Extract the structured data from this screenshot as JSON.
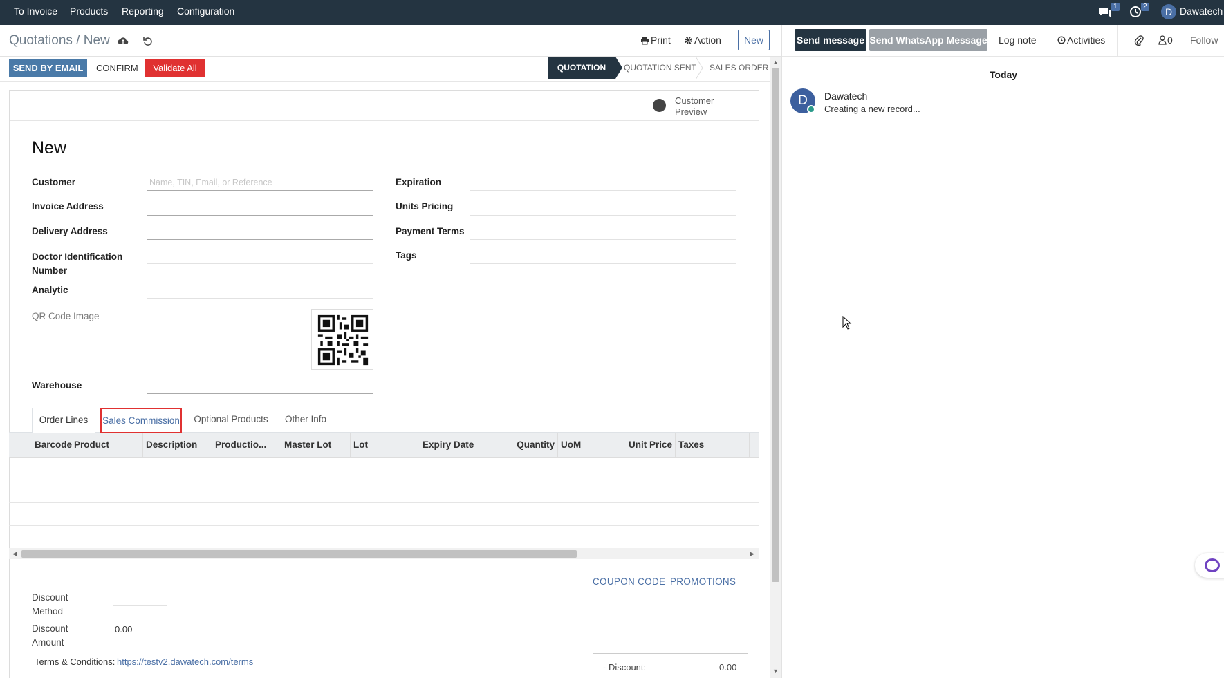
{
  "navbar": {
    "menu": [
      "To Invoice",
      "Products",
      "Reporting",
      "Configuration"
    ],
    "messages_count": "1",
    "activities_count": "2",
    "user_initial": "D",
    "user_name": "Dawatech"
  },
  "control_panel": {
    "breadcrumb_parent": "Quotations",
    "breadcrumb_sep": "/",
    "breadcrumb_current": "New",
    "print_label": "Print",
    "action_label": "Action",
    "new_label": "New"
  },
  "status_bar": {
    "send_email_label": "SEND BY EMAIL",
    "confirm_label": "CONFIRM",
    "validate_all_label": "Validate All",
    "stages": [
      "QUOTATION",
      "QUOTATION SENT",
      "SALES ORDER"
    ],
    "active_stage": "QUOTATION"
  },
  "form": {
    "customer_preview_line1": "Customer",
    "customer_preview_line2": "Preview",
    "title": "New",
    "customer_label": "Customer",
    "customer_placeholder": "Name, TIN, Email, or Reference",
    "invoice_address_label": "Invoice Address",
    "delivery_address_label": "Delivery Address",
    "doctor_id_label_line1": "Doctor Identification",
    "doctor_id_label_line2": "Number",
    "analytic_label": "Analytic",
    "qr_code_label": "QR Code Image",
    "warehouse_label": "Warehouse",
    "expiration_label": "Expiration",
    "units_pricing_label": "Units Pricing",
    "payment_terms_label": "Payment Terms",
    "tags_label": "Tags"
  },
  "tabs": [
    "Order Lines",
    "Sales Commission",
    "Optional Products",
    "Other Info"
  ],
  "table": {
    "columns": [
      "Barcode",
      "Product",
      "Description",
      "Productio...",
      "Master Lot",
      "Lot",
      "Expiry Date",
      "Quantity",
      "UoM",
      "Unit Price",
      "Taxes"
    ]
  },
  "footer": {
    "coupon_code_label": "COUPON CODE",
    "promotions_label": "PROMOTIONS",
    "discount_method_line1": "Discount",
    "discount_method_line2": "Method",
    "discount_amount_line1": "Discount",
    "discount_amount_line2": "Amount",
    "discount_amount_value": "0.00",
    "terms_label": "Terms & Conditions:",
    "terms_link": "https://testv2.dawatech.com/terms",
    "discount_summary_label": "- Discount:",
    "discount_summary_value": "0.00"
  },
  "chatter": {
    "send_message_label": "Send message",
    "send_whatsapp_label": "Send WhatsApp Message",
    "log_note_label": "Log note",
    "activities_label": "Activities",
    "followers_count": "0",
    "follow_label": "Follow",
    "today_label": "Today",
    "message_author_initial": "D",
    "message_author": "Dawatech",
    "message_body": "Creating a new record..."
  }
}
